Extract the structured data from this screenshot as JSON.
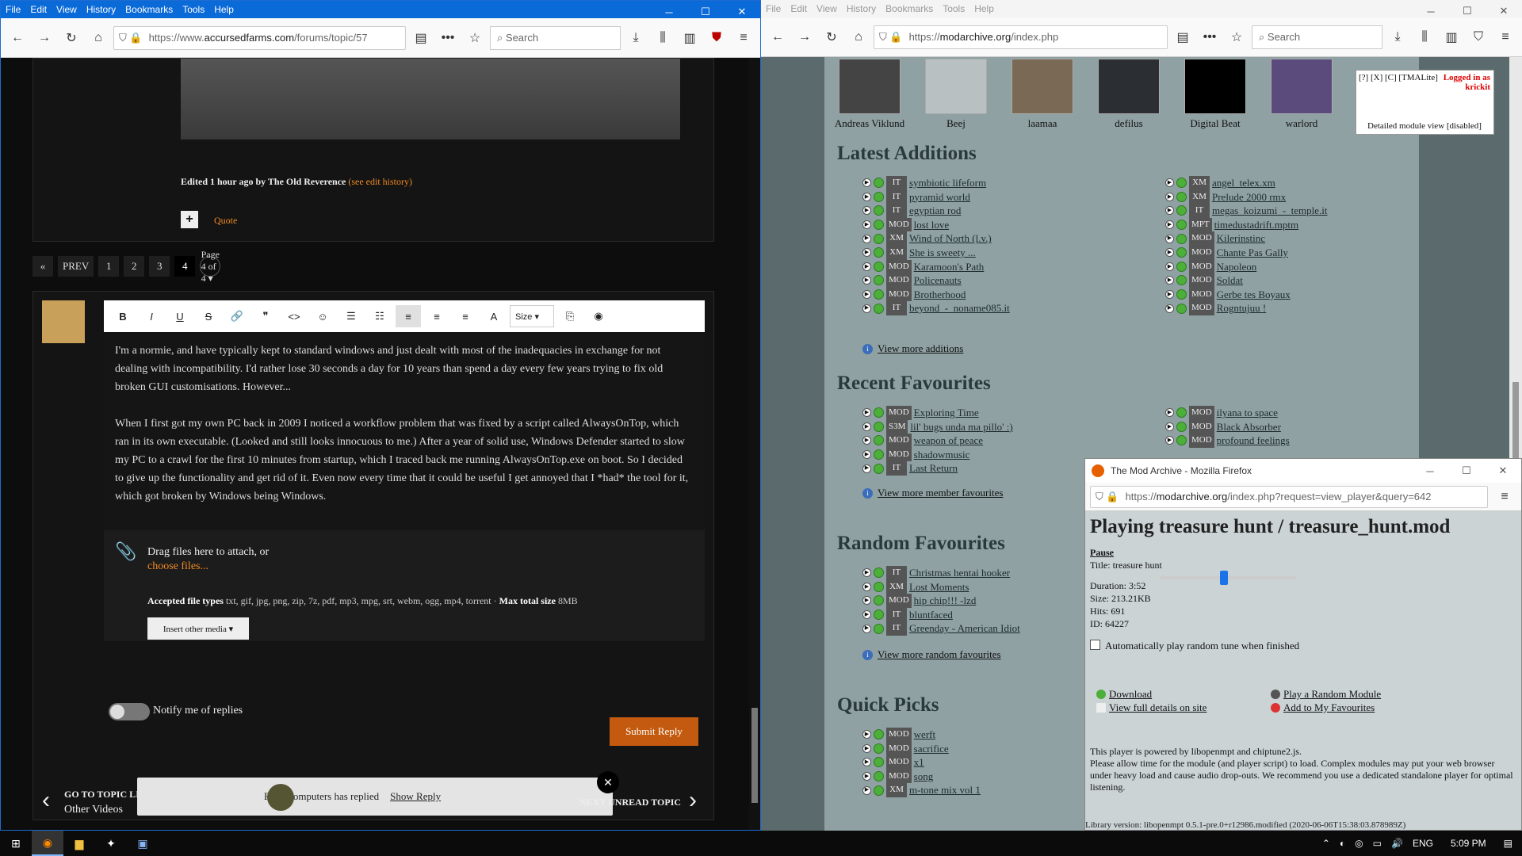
{
  "left_window": {
    "menu": [
      "File",
      "Edit",
      "View",
      "History",
      "Bookmarks",
      "Tools",
      "Help"
    ],
    "window_controls": [
      "─",
      "☐",
      "✕"
    ],
    "url_scheme": "https://www.",
    "url_host": "accursedfarms.com",
    "url_path": "/forums/topic/57",
    "search_placeholder": "Search",
    "edited": {
      "prefix": "Edited 1 hour ago by The Old Reverence",
      "link": "(see edit history)"
    },
    "quote_label": "Quote",
    "pager": {
      "first": "«",
      "prev": "PREV",
      "pages": [
        "1",
        "2",
        "3",
        "4"
      ],
      "label": "Page 4 of 4 ▾"
    },
    "toolbar": [
      "B",
      "I",
      "U",
      "S",
      "🔗",
      "❞",
      "<>",
      "☺",
      "☰",
      "☷",
      "≡",
      "≡",
      "≡",
      "A",
      "Size ▾",
      "⎘",
      "◉"
    ],
    "editor_paragraphs": [
      "I'm a normie, and have typically kept to standard windows and just dealt with most of the inadequacies in exchange for not dealing with incompatibility. I'd rather lose 30 seconds a day for 10 years than spend a day every few years trying to fix old broken GUI customisations. However...",
      "When I first got my own PC back in 2009 I noticed a workflow problem that was fixed by a script called AlwaysOnTop, which ran in its own executable. (Looked and still looks innocuous to me.) After a year of solid use, Windows Defender started to slow my PC to a crawl for the first 10 minutes from startup, which I traced back me running AlwaysOnTop.exe on boot. So I decided to give up the functionality and get rid of it. Even now every time that it could be useful I get annoyed that I *had* the tool for it, which got broken by Windows being Windows."
    ],
    "attach": {
      "drag": "Drag files here to attach, or",
      "choose": "choose files...",
      "accepted_label": "Accepted file types",
      "accepted": "txt, gif, jpg, png, zip, 7z, pdf, mp3, mpg, srt, webm, ogg, mp4, torrent",
      "max_label": "Max total size",
      "max": "8MB",
      "insert": "Insert other media ▾"
    },
    "notify": "Notify me of replies",
    "submit": "Submit Reply",
    "go_to_topic": "GO TO TOPIC LISTING",
    "other_videos": "Other Videos",
    "next_unread": "NEXT UNREAD TOPIC",
    "toast": {
      "text": "FixesComputers has replied",
      "link": "Show Reply",
      "close": "✕"
    }
  },
  "right_window": {
    "menu": [
      "File",
      "Edit",
      "View",
      "History",
      "Bookmarks",
      "Tools",
      "Help"
    ],
    "url_scheme": "https://",
    "url_host": "modarchive.org",
    "url_path": "/index.php",
    "search_placeholder": "Search",
    "favourites": [
      "Andreas Viklund",
      "Beej",
      "laamaa",
      "defilus",
      "Digital Beat",
      "warlord"
    ],
    "infobox": {
      "links": "[?] [X] [C] [TMALite]",
      "logged": "Logged in as krickit",
      "detailed": "Detailed module view [disabled]"
    },
    "latest_additions": {
      "title": "Latest Additions",
      "col1": [
        [
          "IT",
          "symbiotic lifeform"
        ],
        [
          "IT",
          "pyramid world"
        ],
        [
          "IT",
          "egyptian rod"
        ],
        [
          "MOD",
          "lost love"
        ],
        [
          "XM",
          "Wind of North (l.v.)"
        ],
        [
          "XM",
          "She is sweety ..."
        ],
        [
          "MOD",
          "Karamoon's Path"
        ],
        [
          "MOD",
          "Policenauts"
        ],
        [
          "MOD",
          "Brotherhood"
        ],
        [
          "IT",
          "beyond_-_noname085.it"
        ]
      ],
      "col2": [
        [
          "XM",
          "angel_telex.xm"
        ],
        [
          "XM",
          "Prelude 2000 rmx"
        ],
        [
          "IT",
          "megas_koizumi_-_temple.it"
        ],
        [
          "MPT",
          "timedustadrift.mptm"
        ],
        [
          "MOD",
          "Kilerinstinc"
        ],
        [
          "MOD",
          "Chante Pas Gally"
        ],
        [
          "MOD",
          "Napoleon"
        ],
        [
          "MOD",
          "Soldat"
        ],
        [
          "MOD",
          "Gerbe tes Boyaux"
        ],
        [
          "MOD",
          "Rogntujuu !"
        ]
      ],
      "more": "View more additions"
    },
    "recent_favourites": {
      "title": "Recent Favourites",
      "col1": [
        [
          "MOD",
          "Exploring Time"
        ],
        [
          "S3M",
          "lil' bugs unda ma pillo' :)"
        ],
        [
          "MOD",
          "weapon of peace"
        ],
        [
          "MOD",
          "shadowmusic"
        ],
        [
          "IT",
          "Last Return"
        ]
      ],
      "col2": [
        [
          "MOD",
          "ilyana to space"
        ],
        [
          "MOD",
          "Black Absorber"
        ],
        [
          "MOD",
          "profound feelings"
        ]
      ],
      "more": "View more member favourites"
    },
    "random_favourites": {
      "title": "Random Favourites",
      "items": [
        [
          "IT",
          "Christmas hentai hooker"
        ],
        [
          "XM",
          "Lost Moments"
        ],
        [
          "MOD",
          "hip chip!!! -lzd"
        ],
        [
          "IT",
          "bluntfaced"
        ],
        [
          "IT",
          "Greenday - American Idiot"
        ]
      ],
      "more": "View more random favourites"
    },
    "quick_picks": {
      "title": "Quick Picks",
      "items": [
        [
          "MOD",
          "werft"
        ],
        [
          "MOD",
          "sacrifice"
        ],
        [
          "MOD",
          "x1"
        ],
        [
          "MOD",
          "song"
        ],
        [
          "XM",
          "m-tone mix vol 1"
        ]
      ]
    }
  },
  "popup": {
    "title": "The Mod Archive - Mozilla Firefox",
    "url_scheme": "https://",
    "url_host": "modarchive.org",
    "url_path": "/index.php?request=view_player&query=642",
    "heading": "Playing treasure hunt / treasure_hunt.mod",
    "pause": "Pause",
    "title_line": "Title: treasure hunt",
    "duration": "Duration: 3:52",
    "size": "Size: 213.21KB",
    "hits": "Hits: 691",
    "id": "ID: 64227",
    "progress": 0.47,
    "autoplay": "Automatically play random tune when finished",
    "download": "Download",
    "full_details": "View full details on site",
    "random_module": "Play a Random Module",
    "add_fav": "Add to My Favourites",
    "powered": "This player is powered by libopenmpt and chiptune2.js.",
    "notice": "Please allow time for the module (and player script) to load. Complex modules may put your web browser under heavy load and cause audio drop-outs. We recommend you use a dedicated standalone player for optimal listening.",
    "library": "Library version: libopenmpt 0.5.1-pre.0+r12986.modified (2020-06-06T15:38:03.878989Z)"
  },
  "taskbar": {
    "lang": "ENG",
    "time": "5:09 PM"
  }
}
